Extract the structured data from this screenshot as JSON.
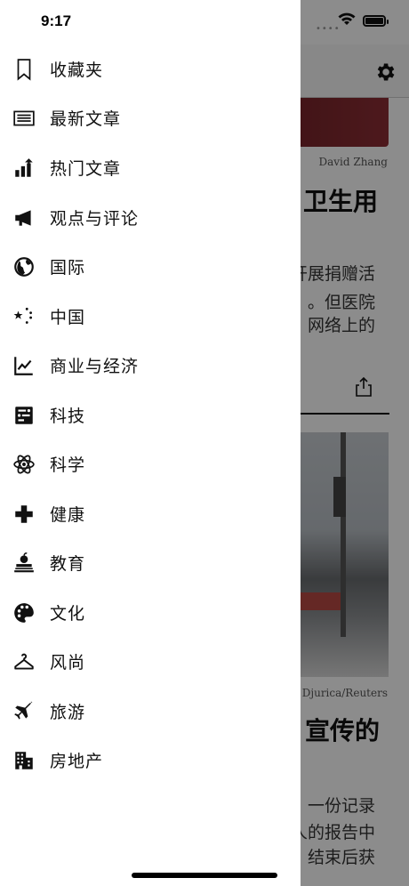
{
  "status": {
    "time": "9:17"
  },
  "drawer": {
    "items": [
      {
        "label": "收藏夹",
        "icon": "bookmark-icon"
      },
      {
        "label": "最新文章",
        "icon": "newspaper-icon"
      },
      {
        "label": "热门文章",
        "icon": "trending-chart-icon"
      },
      {
        "label": "观点与评论",
        "icon": "megaphone-icon"
      },
      {
        "label": "国际",
        "icon": "globe-icon"
      },
      {
        "label": "中国",
        "icon": "stars-icon"
      },
      {
        "label": "商业与经济",
        "icon": "line-chart-icon"
      },
      {
        "label": "科技",
        "icon": "circuit-icon"
      },
      {
        "label": "科学",
        "icon": "atom-icon"
      },
      {
        "label": "健康",
        "icon": "medical-cross-icon"
      },
      {
        "label": "教育",
        "icon": "books-apple-icon"
      },
      {
        "label": "文化",
        "icon": "palette-icon"
      },
      {
        "label": "风尚",
        "icon": "hanger-icon"
      },
      {
        "label": "旅游",
        "icon": "airplane-icon"
      },
      {
        "label": "房地产",
        "icon": "building-icon"
      }
    ]
  },
  "background": {
    "photo_credit_1": "David Zhang",
    "headline_1": "卫生用",
    "body_lines_1": [
      "开展捐赠活",
      "。但医院",
      "网络上的"
    ],
    "photo_credit_2": "o Djurica/Reuters",
    "headline_2": "宣传的",
    "body_lines_2": [
      "一份记录",
      "人的报告中",
      "结束后获"
    ]
  },
  "colors": {
    "overlay": "#000000",
    "drawer_bg": "#ffffff",
    "text": "#111111"
  }
}
